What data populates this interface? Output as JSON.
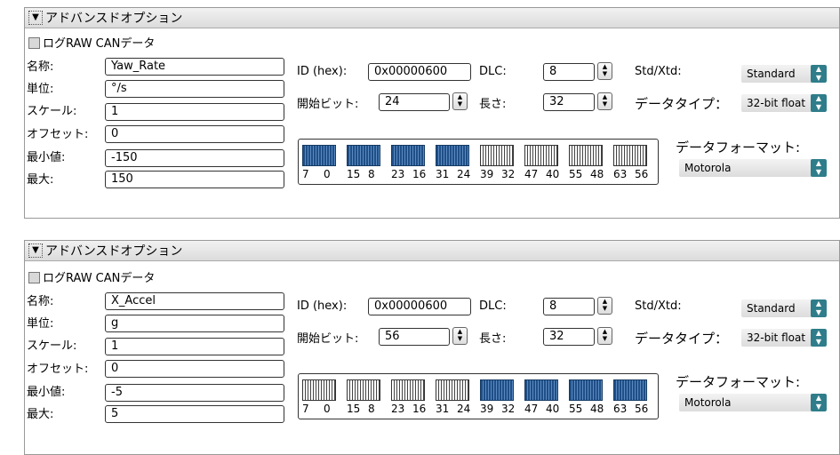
{
  "panels": [
    {
      "header": "アドバンスドオプション",
      "log_raw_label": "ログRAW CANデータ",
      "labels": {
        "name": "名称:",
        "unit": "単位:",
        "scale": "スケール:",
        "offset": "オフセット:",
        "min": "最小値:",
        "max": "最大:",
        "id": "ID (hex):",
        "dlc": "DLC:",
        "stdxtd": "Std/Xtd:",
        "startbit": "開始ビット:",
        "length": "長さ:",
        "datatype": "データタイプ：",
        "format": "データフォーマット:"
      },
      "values": {
        "name": "Yaw_Rate",
        "unit": "°/s",
        "scale": "1",
        "offset": "0",
        "min": "-150",
        "max": "150",
        "id": "0x00000600",
        "dlc": "8",
        "stdxtd": "Standard",
        "startbit": "24",
        "length": "32",
        "datatype": "32-bit float",
        "format": "Motorola"
      },
      "bytes_active": [
        true,
        true,
        true,
        true,
        false,
        false,
        false,
        false
      ]
    },
    {
      "header": "アドバンスドオプション",
      "log_raw_label": "ログRAW CANデータ",
      "labels": {
        "name": "名称:",
        "unit": "単位:",
        "scale": "スケール:",
        "offset": "オフセット:",
        "min": "最小値:",
        "max": "最大:",
        "id": "ID (hex):",
        "dlc": "DLC:",
        "stdxtd": "Std/Xtd:",
        "startbit": "開始ビット:",
        "length": "長さ:",
        "datatype": "データタイプ：",
        "format": "データフォーマット:"
      },
      "values": {
        "name": "X_Accel",
        "unit": "g",
        "scale": "1",
        "offset": "0",
        "min": "-5",
        "max": "5",
        "id": "0x00000600",
        "dlc": "8",
        "stdxtd": "Standard",
        "startbit": "56",
        "length": "32",
        "datatype": "32-bit float",
        "format": "Motorola"
      },
      "bytes_active": [
        false,
        false,
        false,
        false,
        true,
        true,
        true,
        true
      ]
    }
  ],
  "bit_labels": [
    [
      "7",
      "0"
    ],
    [
      "15",
      "8"
    ],
    [
      "23",
      "16"
    ],
    [
      "31",
      "24"
    ],
    [
      "39",
      "32"
    ],
    [
      "47",
      "40"
    ],
    [
      "55",
      "48"
    ],
    [
      "63",
      "56"
    ]
  ],
  "colors": {
    "byte_active": "#1f4f86",
    "select_arrow": "#2f7d8a"
  }
}
